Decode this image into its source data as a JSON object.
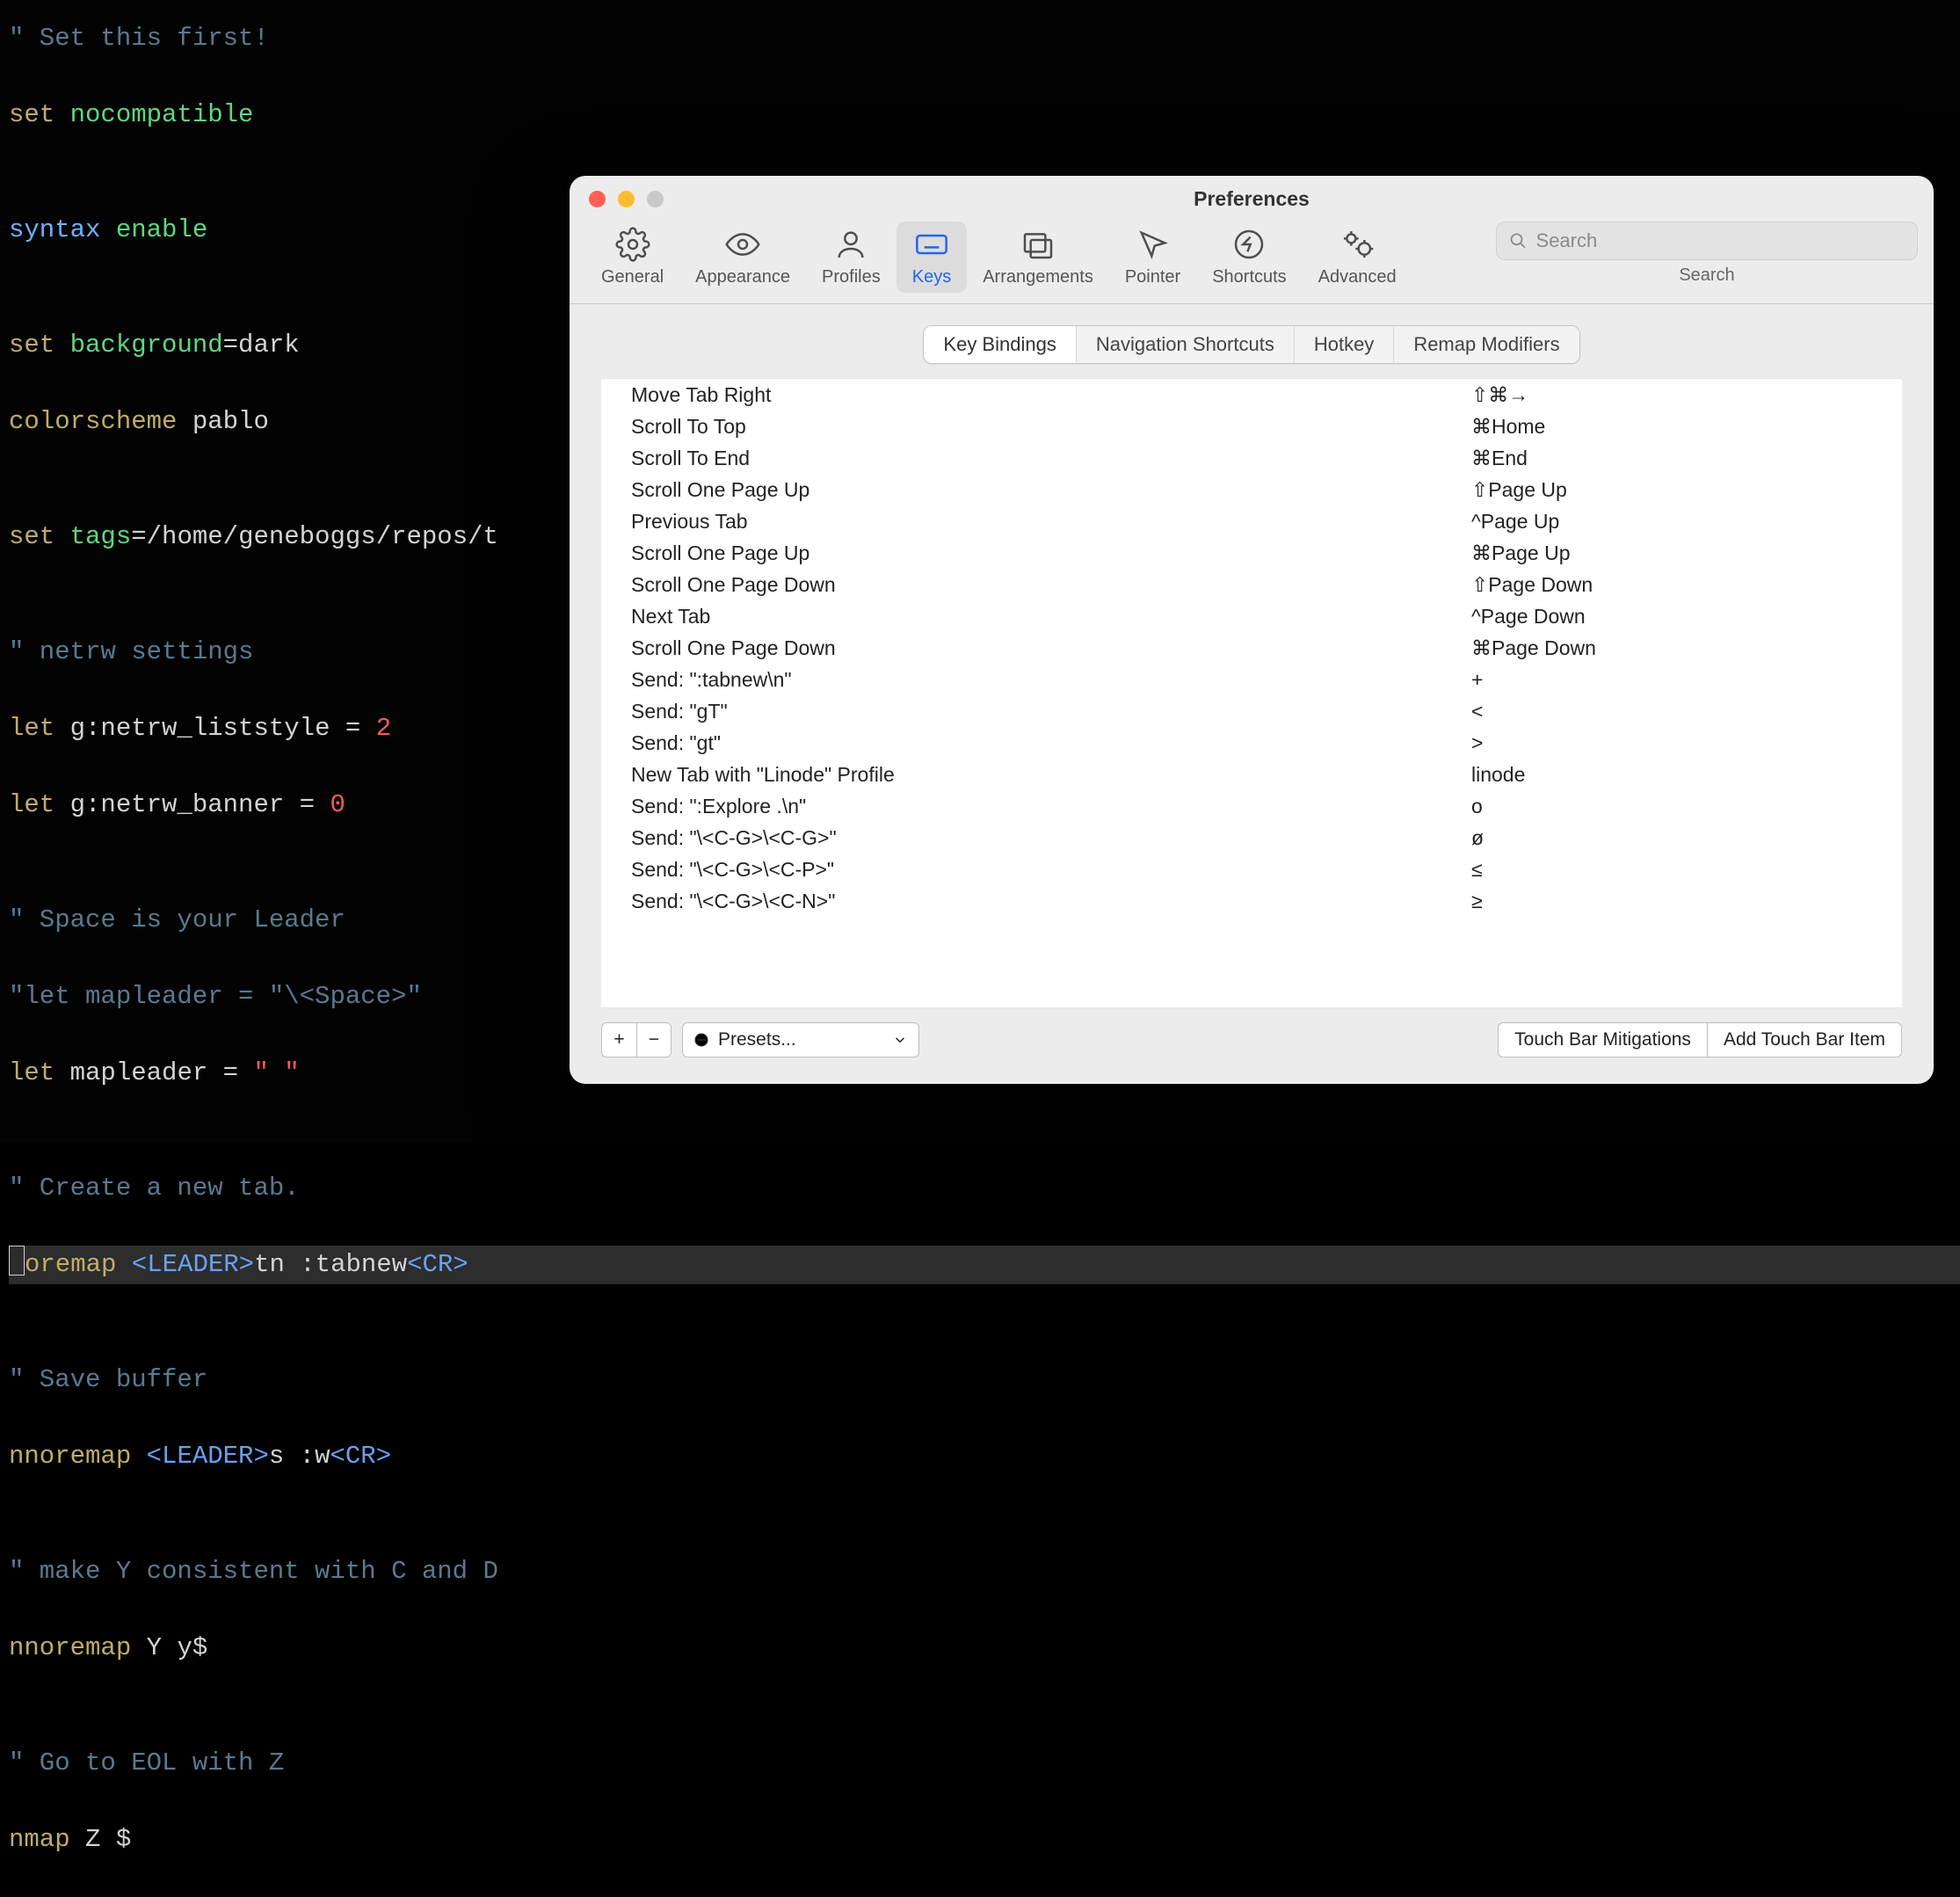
{
  "editor": {
    "lines": [
      {
        "segments": [
          {
            "t": "\" Set this first!",
            "c": "c-comment"
          }
        ]
      },
      {
        "segments": [
          {
            "t": "set ",
            "c": "c-key"
          },
          {
            "t": "nocompatible",
            "c": "c-green"
          }
        ]
      },
      {
        "segments": [
          {
            "t": "",
            "c": "c-white"
          }
        ]
      },
      {
        "segments": [
          {
            "t": "syntax ",
            "c": "c-syntax"
          },
          {
            "t": "enable",
            "c": "c-green"
          }
        ]
      },
      {
        "segments": [
          {
            "t": "",
            "c": "c-white"
          }
        ]
      },
      {
        "segments": [
          {
            "t": "set ",
            "c": "c-key"
          },
          {
            "t": "background",
            "c": "c-green"
          },
          {
            "t": "=dark",
            "c": "c-white"
          }
        ]
      },
      {
        "segments": [
          {
            "t": "colorscheme ",
            "c": "c-key2"
          },
          {
            "t": "pablo",
            "c": "c-white"
          }
        ]
      },
      {
        "segments": [
          {
            "t": "",
            "c": "c-white"
          }
        ]
      },
      {
        "segments": [
          {
            "t": "set ",
            "c": "c-key"
          },
          {
            "t": "tags",
            "c": "c-green"
          },
          {
            "t": "=/home/geneboggs/repos/t",
            "c": "c-white"
          }
        ]
      },
      {
        "segments": [
          {
            "t": "",
            "c": "c-white"
          }
        ]
      },
      {
        "segments": [
          {
            "t": "\" netrw settings",
            "c": "c-comment"
          }
        ]
      },
      {
        "segments": [
          {
            "t": "let ",
            "c": "c-key"
          },
          {
            "t": "g:netrw_liststyle = ",
            "c": "c-white"
          },
          {
            "t": "2",
            "c": "c-red"
          }
        ]
      },
      {
        "segments": [
          {
            "t": "let ",
            "c": "c-key"
          },
          {
            "t": "g:netrw_banner = ",
            "c": "c-white"
          },
          {
            "t": "0",
            "c": "c-red"
          }
        ]
      },
      {
        "segments": [
          {
            "t": "",
            "c": "c-white"
          }
        ]
      },
      {
        "segments": [
          {
            "t": "\" Space is your Leader",
            "c": "c-comment"
          }
        ]
      },
      {
        "segments": [
          {
            "t": "\"let mapleader = \"\\<Space>\"",
            "c": "c-comment"
          }
        ]
      },
      {
        "segments": [
          {
            "t": "let ",
            "c": "c-key"
          },
          {
            "t": "mapleader = ",
            "c": "c-white"
          },
          {
            "t": "\" \"",
            "c": "c-red"
          }
        ]
      },
      {
        "segments": [
          {
            "t": "",
            "c": "c-white"
          }
        ]
      },
      {
        "segments": [
          {
            "t": "\" Create a new tab.",
            "c": "c-comment"
          }
        ]
      },
      {
        "hl": true,
        "segments": [
          {
            "cursor": true
          },
          {
            "t": "oremap ",
            "c": "c-key2"
          },
          {
            "t": "<LEADER>",
            "c": "c-spec"
          },
          {
            "t": "tn :tabnew",
            "c": "c-white"
          },
          {
            "t": "<CR>",
            "c": "c-spec"
          }
        ]
      },
      {
        "segments": [
          {
            "t": "",
            "c": "c-white"
          }
        ]
      },
      {
        "segments": [
          {
            "t": "\" Save buffer",
            "c": "c-comment"
          }
        ]
      },
      {
        "segments": [
          {
            "t": "nnoremap ",
            "c": "c-key2"
          },
          {
            "t": "<LEADER>",
            "c": "c-spec"
          },
          {
            "t": "s :w",
            "c": "c-white"
          },
          {
            "t": "<CR>",
            "c": "c-spec"
          }
        ]
      },
      {
        "segments": [
          {
            "t": "",
            "c": "c-white"
          }
        ]
      },
      {
        "segments": [
          {
            "t": "\" make Y consistent with C and D",
            "c": "c-comment"
          }
        ]
      },
      {
        "segments": [
          {
            "t": "nnoremap ",
            "c": "c-key2"
          },
          {
            "t": "Y y$",
            "c": "c-white"
          }
        ]
      },
      {
        "segments": [
          {
            "t": "",
            "c": "c-white"
          }
        ]
      },
      {
        "segments": [
          {
            "t": "\" Go to EOL with Z",
            "c": "c-comment"
          }
        ]
      },
      {
        "segments": [
          {
            "t": "nmap ",
            "c": "c-key2"
          },
          {
            "t": "Z $",
            "c": "c-white"
          }
        ]
      }
    ]
  },
  "window": {
    "title": "Preferences",
    "traffic": {
      "close": "#ff5f57",
      "min": "#febc2e",
      "max": "#c8c8c8"
    },
    "toolbar": [
      {
        "id": "general",
        "label": "General"
      },
      {
        "id": "appearance",
        "label": "Appearance"
      },
      {
        "id": "profiles",
        "label": "Profiles"
      },
      {
        "id": "keys",
        "label": "Keys",
        "active": true
      },
      {
        "id": "arrangements",
        "label": "Arrangements"
      },
      {
        "id": "pointer",
        "label": "Pointer"
      },
      {
        "id": "shortcuts",
        "label": "Shortcuts"
      },
      {
        "id": "advanced",
        "label": "Advanced"
      }
    ],
    "search": {
      "placeholder": "Search",
      "label": "Search"
    },
    "segments": [
      {
        "label": "Key Bindings",
        "active": true
      },
      {
        "label": "Navigation Shortcuts"
      },
      {
        "label": "Hotkey"
      },
      {
        "label": "Remap Modifiers"
      }
    ],
    "bindings": [
      {
        "action": "Move Tab Right",
        "shortcut": "⇧⌘→"
      },
      {
        "action": "Scroll To Top",
        "shortcut": "⌘Home"
      },
      {
        "action": "Scroll To End",
        "shortcut": "⌘End"
      },
      {
        "action": "Scroll One Page Up",
        "shortcut": "⇧Page Up"
      },
      {
        "action": "Previous Tab",
        "shortcut": "^Page Up"
      },
      {
        "action": "Scroll One Page Up",
        "shortcut": "⌘Page Up"
      },
      {
        "action": "Scroll One Page Down",
        "shortcut": "⇧Page Down"
      },
      {
        "action": "Next Tab",
        "shortcut": "^Page Down"
      },
      {
        "action": "Scroll One Page Down",
        "shortcut": "⌘Page Down"
      },
      {
        "action": "Send: \":tabnew\\n\"",
        "shortcut": "+"
      },
      {
        "action": "Send: \"gT\"",
        "shortcut": "<"
      },
      {
        "action": "Send: \"gt\"",
        "shortcut": ">"
      },
      {
        "action": "New Tab with \"Linode\" Profile",
        "shortcut": "linode"
      },
      {
        "action": "Send: \":Explore .\\n\"",
        "shortcut": "o"
      },
      {
        "action": "Send: \"\\<C-G>\\<C-G>\"",
        "shortcut": "ø"
      },
      {
        "action": "Send: \"\\<C-G>\\<C-P>\"",
        "shortcut": "≤"
      },
      {
        "action": "Send: \"\\<C-G>\\<C-N>\"",
        "shortcut": "≥"
      }
    ],
    "bottom": {
      "add": "+",
      "remove": "−",
      "more": "⋯",
      "presets": "Presets...",
      "touchbar_mitigations": "Touch Bar Mitigations",
      "add_touchbar": "Add Touch Bar Item"
    }
  }
}
